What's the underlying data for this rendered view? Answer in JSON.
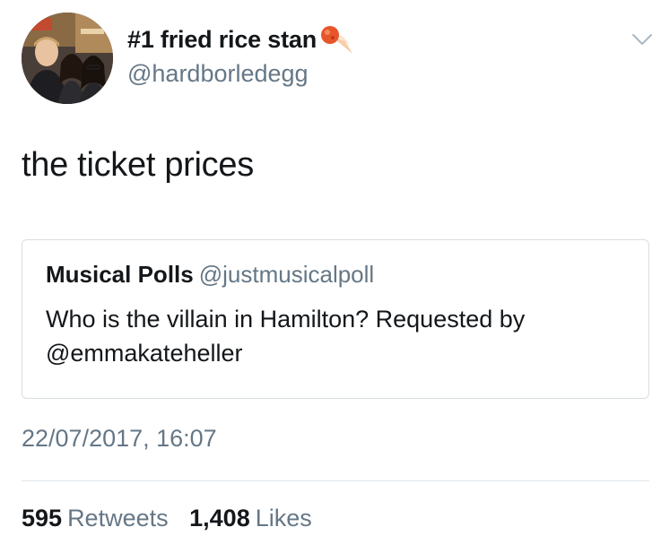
{
  "tweet": {
    "author": {
      "display_name": "#1 fried rice stan",
      "handle": "@hardborledegg",
      "name_emoji": "meteor-emoji",
      "avatar": "profile-photo-three-people"
    },
    "text": "the ticket prices",
    "quoted_tweet": {
      "display_name": "Musical Polls",
      "handle": "@justmusicalpoll",
      "text": "Who is the villain in Hamilton? Requested by @emmakateheller"
    },
    "timestamp": "22/07/2017, 16:07",
    "stats": {
      "retweets_count": "595",
      "retweets_label": "Retweets",
      "likes_count": "1,408",
      "likes_label": "Likes"
    },
    "menu_icon": "chevron-down-icon"
  },
  "colors": {
    "primary_text": "#14171a",
    "secondary_text": "#657786",
    "border": "#d8dee3",
    "divider": "#e1e8ed"
  }
}
